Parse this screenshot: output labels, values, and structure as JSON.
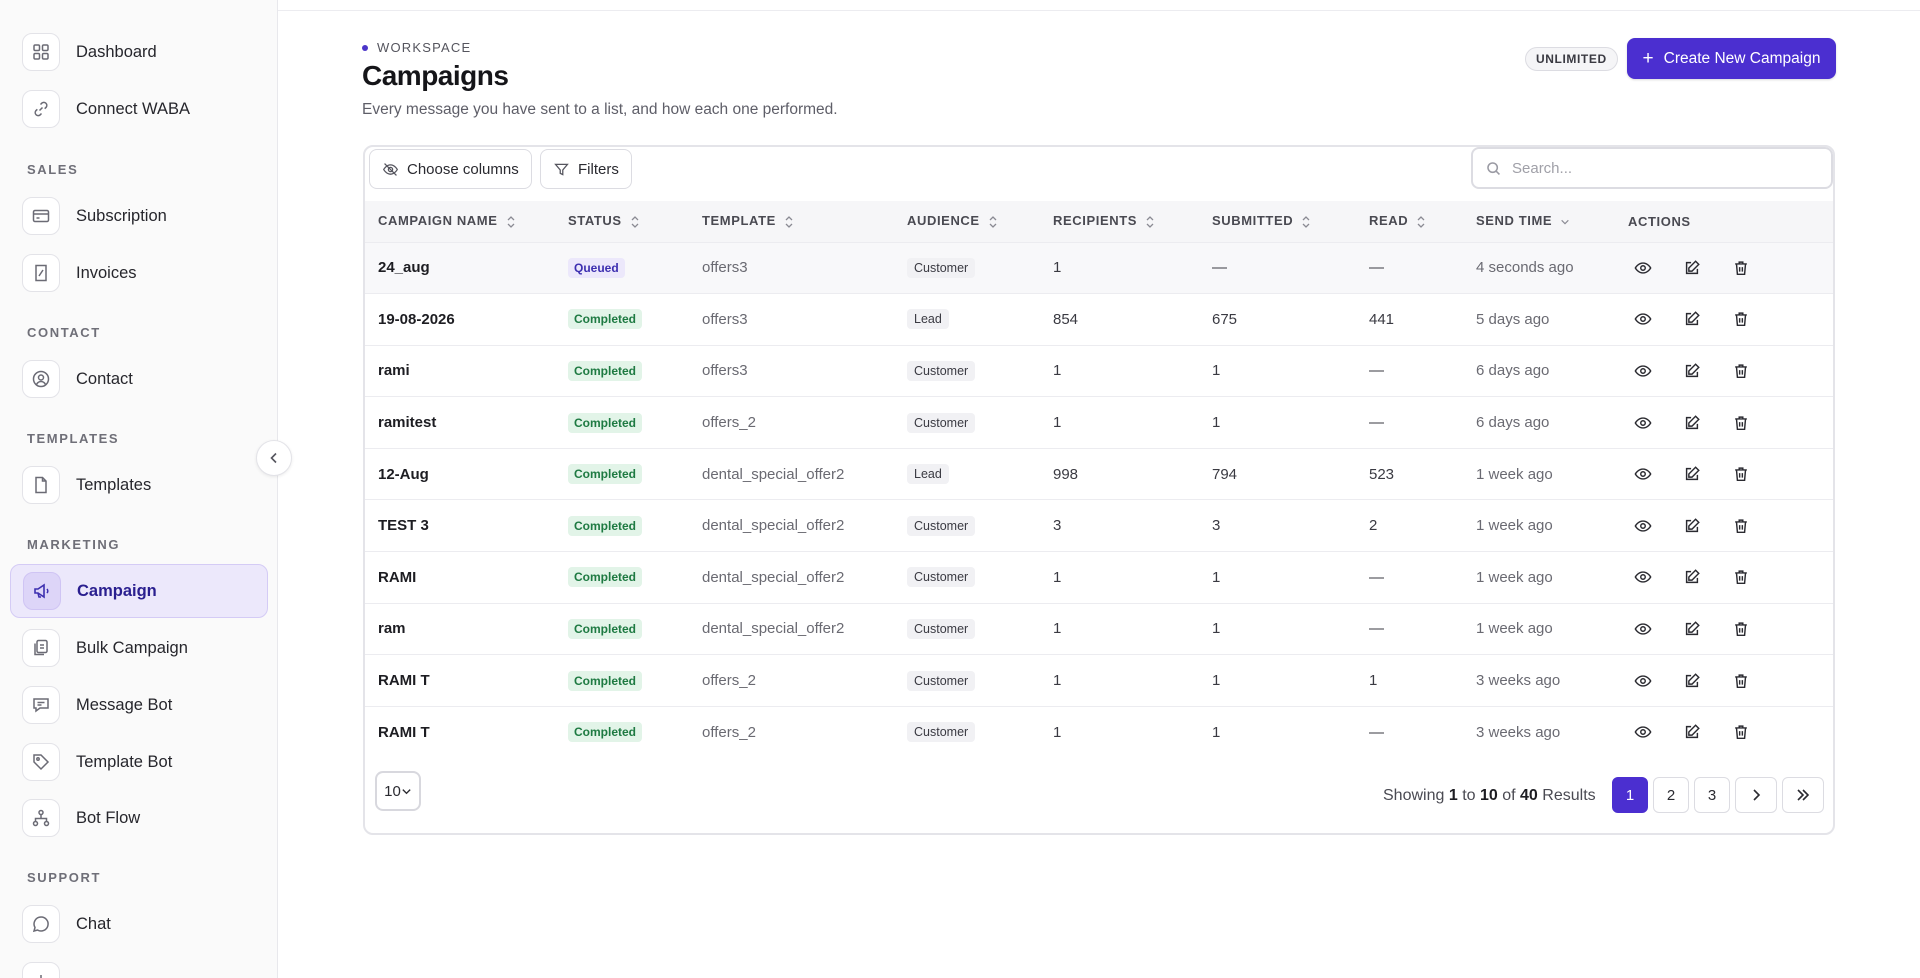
{
  "sidebar": {
    "items_top": [
      {
        "label": "Dashboard",
        "icon": "grid-icon"
      },
      {
        "label": "Connect WABA",
        "icon": "link-icon"
      }
    ],
    "sections": [
      {
        "title": "SALES",
        "items": [
          {
            "label": "Subscription",
            "icon": "card-icon"
          },
          {
            "label": "Invoices",
            "icon": "invoice-icon"
          }
        ]
      },
      {
        "title": "CONTACT",
        "items": [
          {
            "label": "Contact",
            "icon": "user-icon"
          }
        ]
      },
      {
        "title": "TEMPLATES",
        "items": [
          {
            "label": "Templates",
            "icon": "file-icon"
          }
        ]
      },
      {
        "title": "MARKETING",
        "items": [
          {
            "label": "Campaign",
            "icon": "megaphone-icon",
            "active": true
          },
          {
            "label": "Bulk Campaign",
            "icon": "bulk-icon"
          },
          {
            "label": "Message Bot",
            "icon": "message-icon"
          },
          {
            "label": "Template Bot",
            "icon": "tag-icon"
          },
          {
            "label": "Bot Flow",
            "icon": "flow-icon"
          }
        ]
      },
      {
        "title": "SUPPORT",
        "items": [
          {
            "label": "Chat",
            "icon": "chat-icon"
          }
        ]
      }
    ]
  },
  "header": {
    "eyebrow": "WORKSPACE",
    "title": "Campaigns",
    "subtitle": "Every message you have sent to a list, and how each one performed.",
    "plan_badge": "UNLIMITED",
    "create_label": "Create New Campaign"
  },
  "toolbar": {
    "choose_columns": "Choose columns",
    "filters": "Filters",
    "search_placeholder": "Search..."
  },
  "table": {
    "columns": [
      "CAMPAIGN NAME",
      "STATUS",
      "TEMPLATE",
      "AUDIENCE",
      "RECIPIENTS",
      "SUBMITTED",
      "READ",
      "SEND TIME",
      "ACTIONS"
    ],
    "rows": [
      {
        "name": "24_aug",
        "status": "Queued",
        "template": "offers3",
        "audience": "Customer",
        "recipients": "1",
        "submitted": "—",
        "read": "—",
        "send_time": "4 seconds ago"
      },
      {
        "name": "19-08-2026",
        "status": "Completed",
        "template": "offers3",
        "audience": "Lead",
        "recipients": "854",
        "submitted": "675",
        "read": "441",
        "send_time": "5 days ago"
      },
      {
        "name": "rami",
        "status": "Completed",
        "template": "offers3",
        "audience": "Customer",
        "recipients": "1",
        "submitted": "1",
        "read": "—",
        "send_time": "6 days ago"
      },
      {
        "name": "ramitest",
        "status": "Completed",
        "template": "offers_2",
        "audience": "Customer",
        "recipients": "1",
        "submitted": "1",
        "read": "—",
        "send_time": "6 days ago"
      },
      {
        "name": "12-Aug",
        "status": "Completed",
        "template": "dental_special_offer2",
        "audience": "Lead",
        "recipients": "998",
        "submitted": "794",
        "read": "523",
        "send_time": "1 week ago"
      },
      {
        "name": "TEST 3",
        "status": "Completed",
        "template": "dental_special_offer2",
        "audience": "Customer",
        "recipients": "3",
        "submitted": "3",
        "read": "2",
        "send_time": "1 week ago"
      },
      {
        "name": "RAMI",
        "status": "Completed",
        "template": "dental_special_offer2",
        "audience": "Customer",
        "recipients": "1",
        "submitted": "1",
        "read": "—",
        "send_time": "1 week ago"
      },
      {
        "name": "ram",
        "status": "Completed",
        "template": "dental_special_offer2",
        "audience": "Customer",
        "recipients": "1",
        "submitted": "1",
        "read": "—",
        "send_time": "1 week ago"
      },
      {
        "name": "RAMI T",
        "status": "Completed",
        "template": "offers_2",
        "audience": "Customer",
        "recipients": "1",
        "submitted": "1",
        "read": "1",
        "send_time": "3 weeks ago"
      },
      {
        "name": "RAMI T",
        "status": "Completed",
        "template": "offers_2",
        "audience": "Customer",
        "recipients": "1",
        "submitted": "1",
        "read": "—",
        "send_time": "3 weeks ago"
      }
    ]
  },
  "footer": {
    "page_size": "10",
    "results_prefix": "Showing",
    "range_start": "1",
    "to": "to",
    "range_end": "10",
    "of": "of",
    "total": "40",
    "results_suffix": "Results",
    "pages": [
      "1",
      "2",
      "3"
    ],
    "current_page": "1"
  },
  "colors": {
    "accent": "#4b2fd0",
    "completed_bg": "#e2f4e8",
    "completed_text": "#1e7a42",
    "queued_bg": "#ece8fb"
  }
}
